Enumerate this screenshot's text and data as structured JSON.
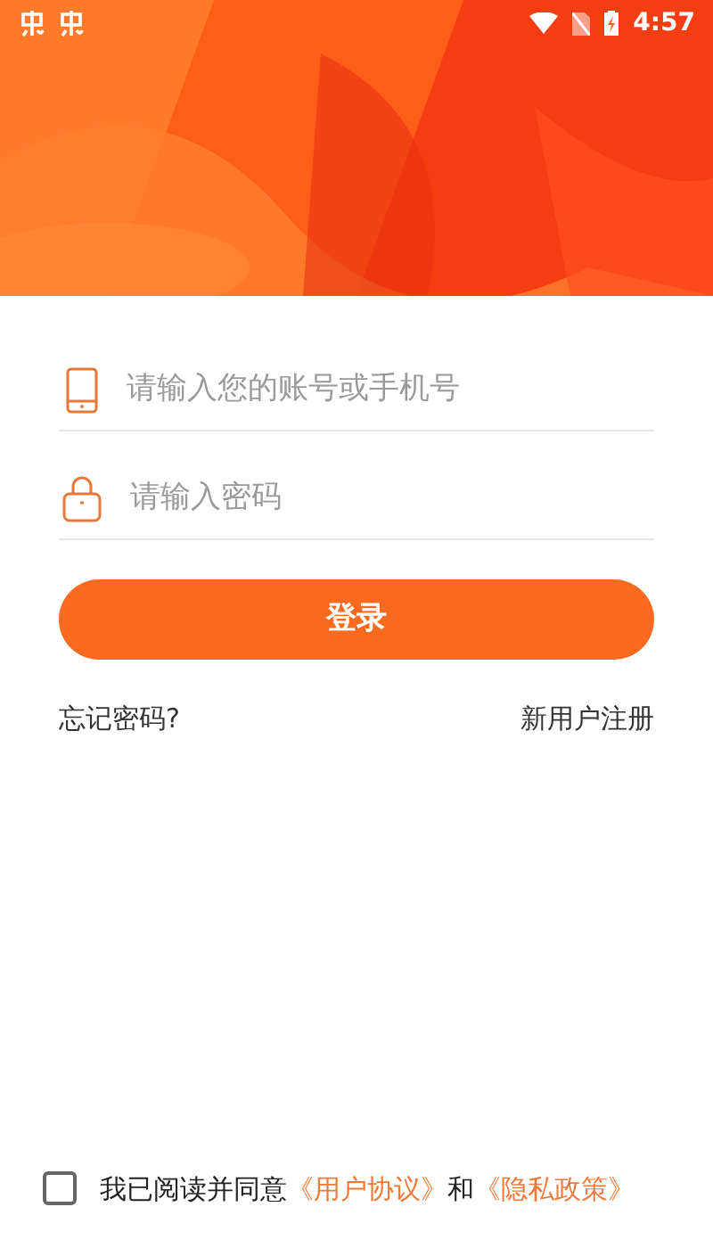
{
  "status_bar": {
    "time": "4:57"
  },
  "form": {
    "account": {
      "placeholder": "请输入您的账号或手机号"
    },
    "password": {
      "placeholder": "请输入密码"
    },
    "login_button": "登录",
    "forgot_password": "忘记密码?",
    "register": "新用户注册"
  },
  "agreement": {
    "checked": false,
    "prefix": "我已阅读并同意",
    "links": [
      {
        "label": "《用户协议》"
      },
      {
        "label": "《隐私政策》"
      }
    ],
    "joiner": "和"
  }
}
